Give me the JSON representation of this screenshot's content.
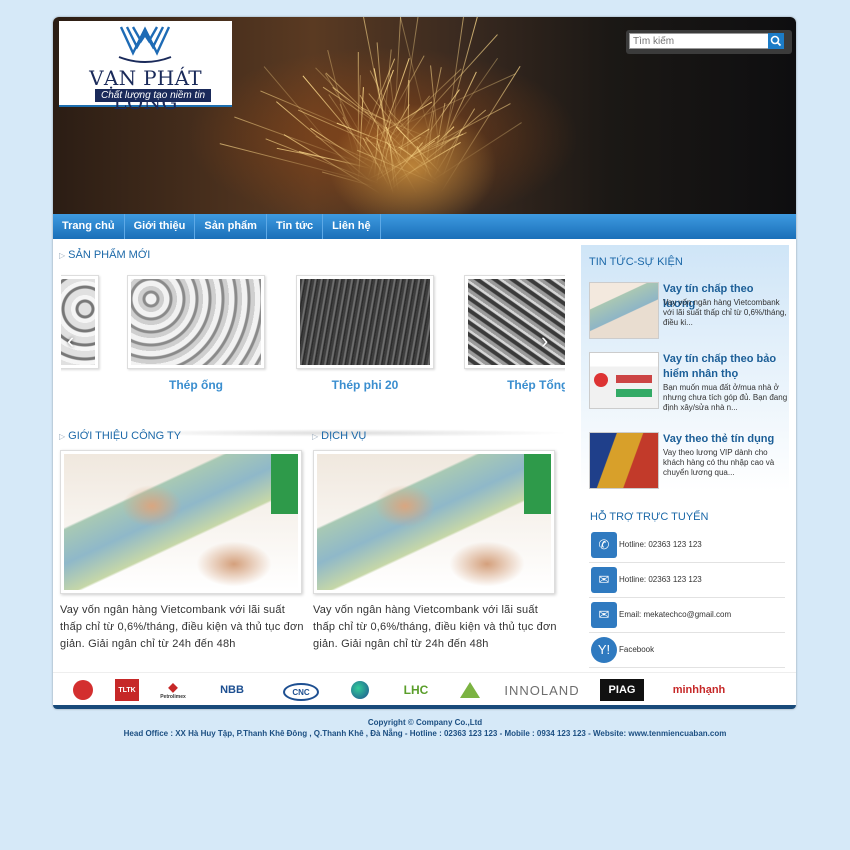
{
  "brand": {
    "name": "VẠN PHÁT LONG",
    "tagline": "Chất lượng tạo niềm tin"
  },
  "search": {
    "placeholder": "Tìm kiếm"
  },
  "nav": [
    "Trang chủ",
    "Giới thiệu",
    "Sản phẩm",
    "Tin tức",
    "Liên hệ"
  ],
  "new_products": {
    "title": "SẢN PHẨM MỚI",
    "items": [
      {
        "label": "ng"
      },
      {
        "label": "Thép ống"
      },
      {
        "label": "Thép phi 20"
      },
      {
        "label": "Thép Tổng Hợ"
      }
    ]
  },
  "intro": {
    "title": "GIỚI THIỆU CÔNG TY",
    "text": "Vay vốn ngân hàng Vietcombank  với lãi suất thấp chỉ từ 0,6%/tháng, điều kiện và thủ tục đơn giản. Giải ngân chỉ từ 24h đến 48h"
  },
  "services": {
    "title": "DỊCH VỤ",
    "text": "Vay vốn ngân hàng Vietcombank  với lãi suất thấp chỉ từ 0,6%/tháng, điều kiện và thủ tục đơn giản. Giải ngân chỉ từ 24h đến 48h"
  },
  "news": {
    "title": "TIN TỨC-SỰ KIỆN",
    "items": [
      {
        "title": "Vay tín chấp theo lương",
        "desc": "Vay vốn ngân hàng Vietcombank  với lãi suất thấp chỉ từ 0,6%/tháng, điều ki..."
      },
      {
        "title": "Vay tín chấp theo bảo hiểm nhân thọ",
        "desc": "Bạn muốn mua đất ở/mua nhà ở nhưng chưa tích góp đủ. Bạn đang định xây/sửa nhà n..."
      },
      {
        "title": "Vay theo thẻ tín dụng",
        "desc": " Vay theo lương VIP dành cho khách hàng có thu nhập cao và chuyển lương qua..."
      }
    ]
  },
  "support": {
    "title": "HỖ TRỢ TRỰC TUYẾN",
    "items": [
      {
        "icon": "phone-icon",
        "text": "Hotline: 02363 123 123"
      },
      {
        "icon": "chat-icon",
        "text": "Hotline: 02363 123 123"
      },
      {
        "icon": "email-icon",
        "text": "Email: mekatechco@gmail.com"
      },
      {
        "icon": "yahoo-icon",
        "text": "Facebook"
      }
    ]
  },
  "partners": [
    "LICOGI",
    "TLTK",
    "Petrolimex",
    "NBB",
    "CNC",
    "",
    "LHC",
    "",
    "INNOLAND",
    "PIAG",
    "minhhạnh"
  ],
  "footer": {
    "copyright": "Copyright © Company Co.,Ltd",
    "address": "Head Office : XX Hà Huy Tập, P.Thanh Khê Đông , Q.Thanh Khê , Đà Nẵng - Hotline : 02363 123 123 - Mobile : 0934 123 123 - Website: www.tenmiencuaban.com"
  },
  "colors": {
    "accent": "#1b6fb8",
    "link": "#3a8ecf",
    "page_bg": "#d6e9f8"
  }
}
